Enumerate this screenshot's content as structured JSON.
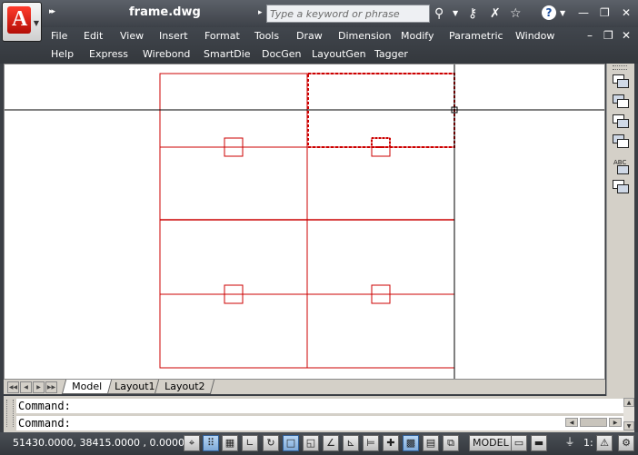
{
  "titlebar": {
    "app_logo_letter": "A",
    "qat_arrows": "▸▸",
    "doc_title": "frame.dwg",
    "search_placeholder": "Type a keyword or phrase",
    "search_arrow": "▸",
    "icons": [
      "binoculars-icon",
      "key-icon",
      "exchange-icon",
      "star-icon",
      "help-icon"
    ]
  },
  "menu": {
    "row1": [
      "File",
      "Edit",
      "View",
      "Insert",
      "Format",
      "Tools",
      "Draw",
      "Dimension",
      "Modify",
      "Parametric",
      "Window"
    ],
    "row2": [
      "Help",
      "Express",
      "Wirebond",
      "SmartDie",
      "DocGen",
      "LayoutGen",
      "Tagger"
    ]
  },
  "tabs": [
    "Model",
    "Layout1",
    "Layout2"
  ],
  "active_tab": "Model",
  "command": {
    "line1": "Command:",
    "line2": "Command:"
  },
  "status": {
    "coordinates": "51430.0000,  38415.0000 , 0.0000",
    "model_label": "MODEL",
    "scale": "1:"
  },
  "colors": {
    "drawing_lines": "#cc0000",
    "crosshair": "#000000",
    "selection": "#cc0000"
  }
}
